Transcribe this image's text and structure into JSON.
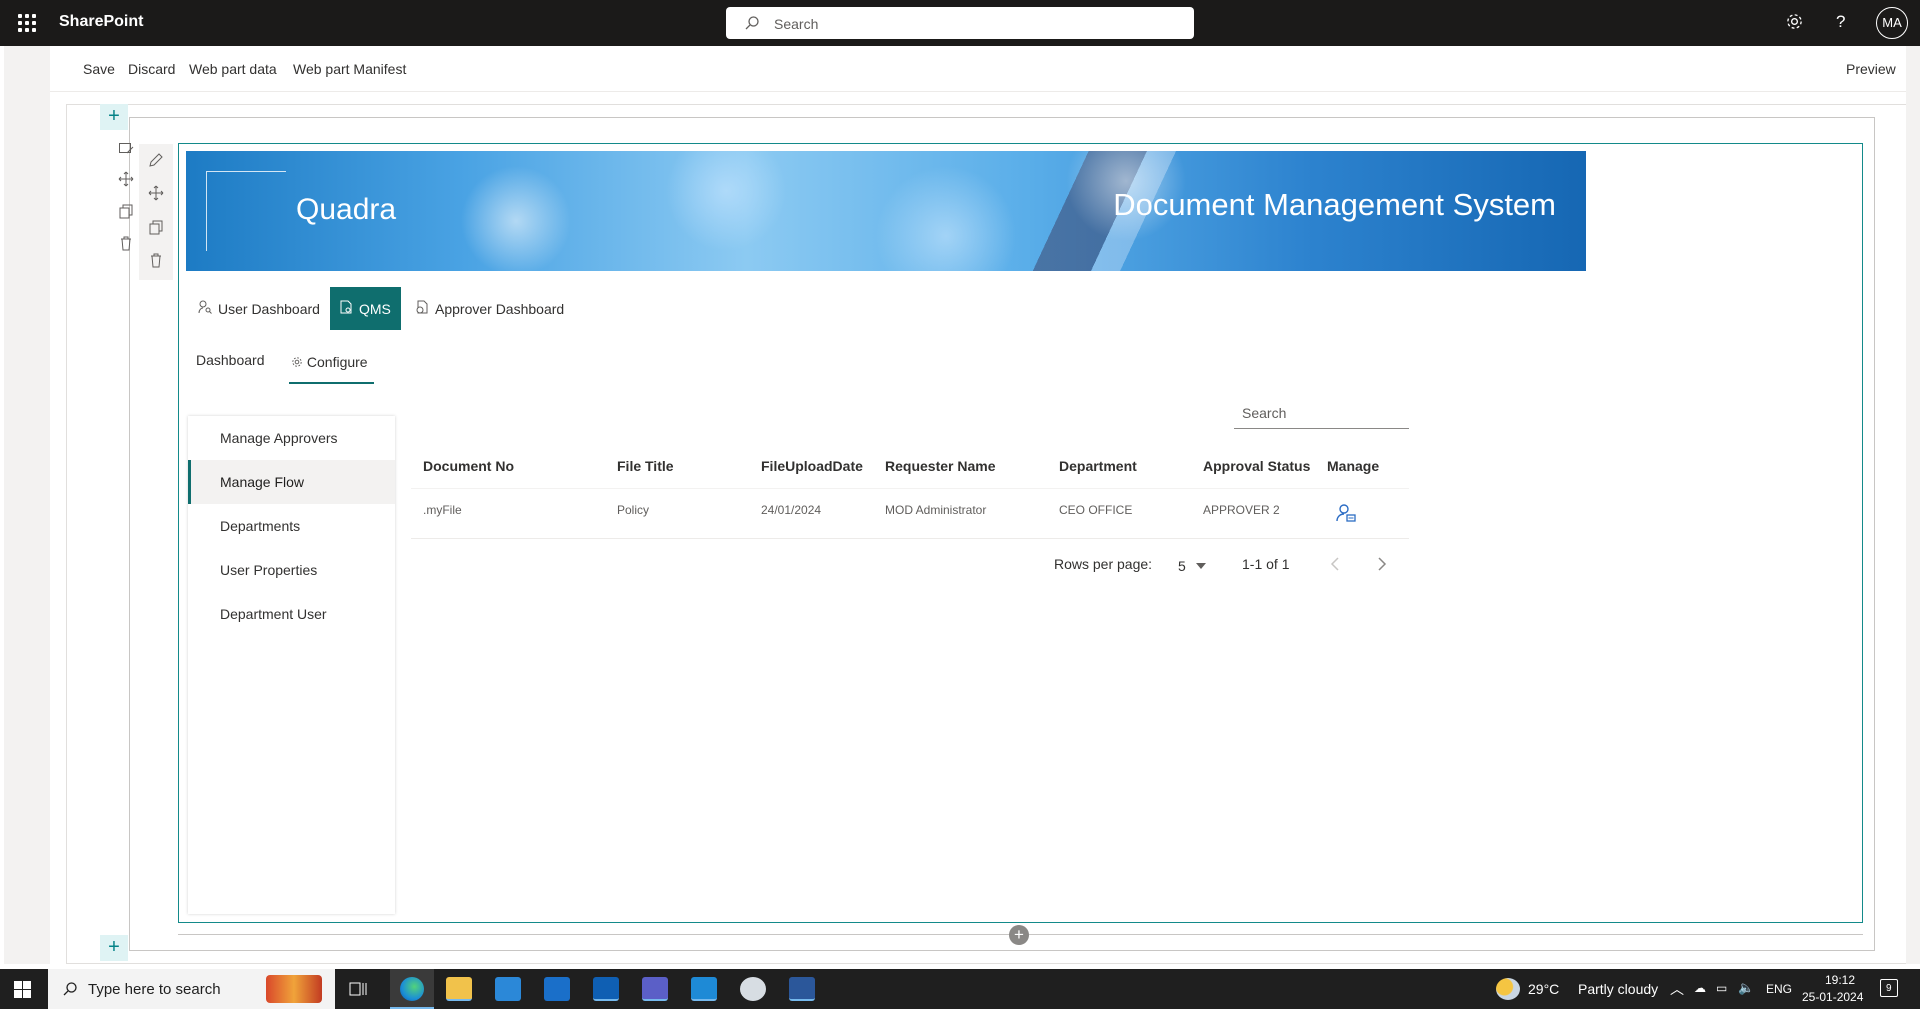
{
  "suitebar": {
    "brand": "SharePoint",
    "search_placeholder": "Search",
    "avatar_initials": "MA",
    "settings_icon": "gear-icon",
    "help_icon": "question-icon"
  },
  "commandbar": {
    "save": "Save",
    "discard": "Discard",
    "web_part_data": "Web part data",
    "web_part_manifest": "Web part Manifest",
    "preview": "Preview"
  },
  "banner": {
    "company": "Quadra",
    "title": "Document Management System"
  },
  "main_tabs": [
    {
      "label": "User Dashboard",
      "icon": "user-search-icon",
      "active": false
    },
    {
      "label": "QMS",
      "icon": "document-icon",
      "active": true
    },
    {
      "label": "Approver Dashboard",
      "icon": "approver-icon",
      "active": false
    }
  ],
  "pivot": [
    {
      "label": "Dashboard",
      "active": false
    },
    {
      "label": "Configure",
      "icon": "gear-icon",
      "active": true
    }
  ],
  "sidenav": [
    {
      "label": "Manage Approvers",
      "active": false
    },
    {
      "label": "Manage Flow",
      "active": true
    },
    {
      "label": "Departments",
      "active": false
    },
    {
      "label": "User Properties",
      "active": false
    },
    {
      "label": "Department User",
      "active": false
    }
  ],
  "table": {
    "search_placeholder": "Search",
    "columns": [
      "Document No",
      "File Title",
      "FileUploadDate",
      "Requester Name",
      "Department",
      "Approval Status",
      "Manage"
    ],
    "rows": [
      [
        ".myFile",
        "Policy",
        "24/01/2024",
        "MOD Administrator",
        "CEO OFFICE",
        "APPROVER 2",
        "manage-user-icon"
      ]
    ],
    "pager": {
      "rows_per_page_label": "Rows per page:",
      "rows_per_page_value": "5",
      "range": "1-1 of 1"
    }
  },
  "taskbar": {
    "search_placeholder": "Type here to search",
    "weather_temp": "29°C",
    "weather_desc": "Partly cloudy",
    "language": "ENG",
    "time": "19:12",
    "date": "25-01-2024",
    "notification_count": "9"
  },
  "colors": {
    "accent": "#0f6e6e",
    "suitebar": "#1b1a19",
    "webpart_border": "#138a8a"
  }
}
